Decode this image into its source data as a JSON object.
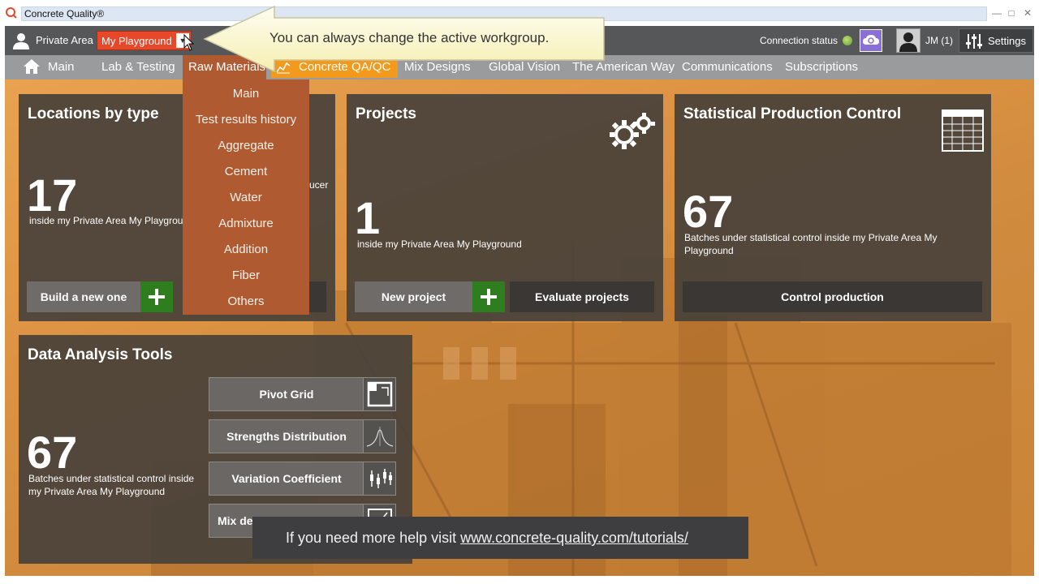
{
  "window": {
    "title": "Concrete Quality®"
  },
  "header": {
    "private_area_label": "Private Area",
    "workgroup_selected": "My Playground",
    "connection_label": "Connection status",
    "user_name": "JM (1)",
    "settings_label": "Settings"
  },
  "callout": {
    "text": "You can always change the active workgroup."
  },
  "nav": {
    "items": [
      "Main",
      "Lab & Testing",
      "Raw Materials",
      "Concrete QA/QC",
      "Mix Designs",
      "Global Vision",
      "The American Way",
      "Communications",
      "Subscriptions"
    ]
  },
  "dropdown": {
    "items": [
      "Main",
      "Test results history",
      "Aggregate",
      "Cement",
      "Water",
      "Admixture",
      "Addition",
      "Fiber",
      "Others"
    ]
  },
  "cards": {
    "locations": {
      "title": "Locations by type",
      "count": "17",
      "caption": "inside my Private Area My Playgrou",
      "partial_text": "ucer",
      "button": "Build a new one"
    },
    "projects": {
      "title": "Projects",
      "count": "1",
      "caption": "inside my Private Area My Playground",
      "new_button": "New project",
      "evaluate_button": "Evaluate projects"
    },
    "spc": {
      "title": "Statistical Production Control",
      "count": "67",
      "caption": "Batches under statistical control inside my Private Area My Playground",
      "button": "Control production"
    },
    "data_analysis": {
      "title": "Data Analysis Tools",
      "count": "67",
      "caption": "Batches under statistical control inside my Private Area My Playground",
      "tools": [
        "Pivot Grid",
        "Strengths Distribution",
        "Variation Coefficient",
        "Mix de"
      ]
    }
  },
  "help": {
    "prefix": "If you need more help visit ",
    "link": "www.concrete-quality.com/tutorials/"
  }
}
